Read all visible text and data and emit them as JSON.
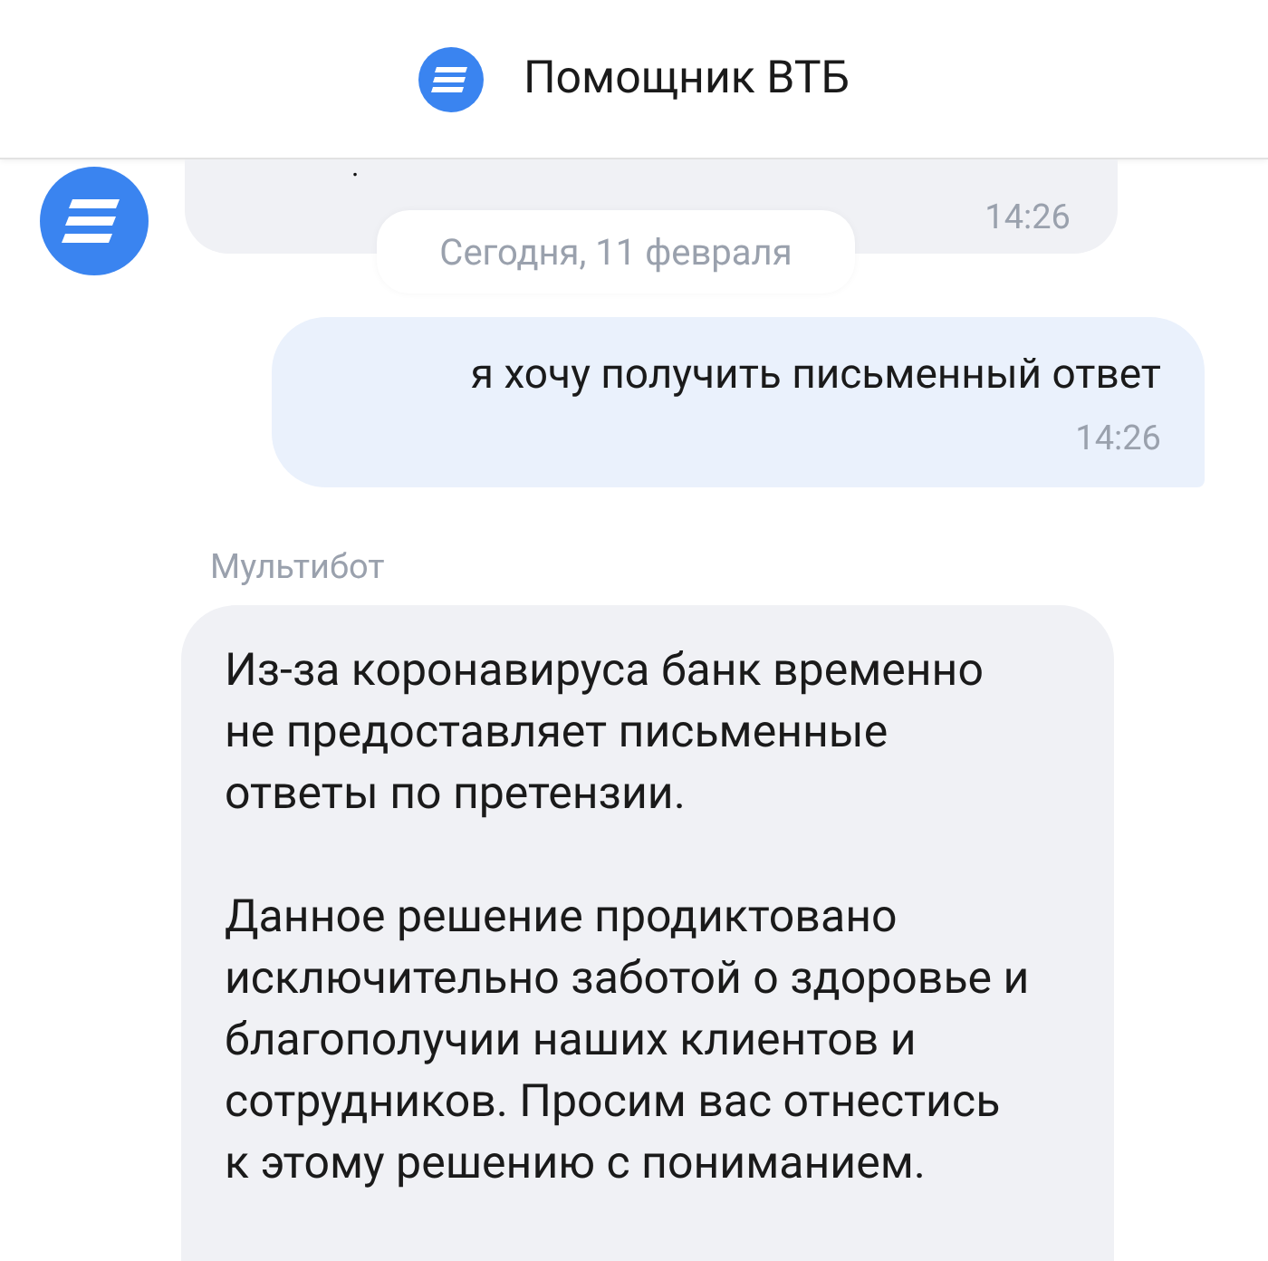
{
  "header": {
    "title": "Помощник ВТБ"
  },
  "date_separator": "Сегодня, 11 февраля",
  "messages": [
    {
      "kind": "bot_partial",
      "text": ".",
      "time": "14:26"
    },
    {
      "kind": "user",
      "text": "я хочу получить письменный ответ",
      "time": "14:26"
    },
    {
      "kind": "bot",
      "sender": "Мультибот",
      "paragraphs": [
        "Из-за коронавируса банк временно не предоставляет письменные ответы по претензии.",
        "Данное решение продиктовано исключительно заботой о здоровье и благополучии наших клиентов и сотрудников. Просим вас отнестись к этому решению с пониманием."
      ]
    }
  ]
}
